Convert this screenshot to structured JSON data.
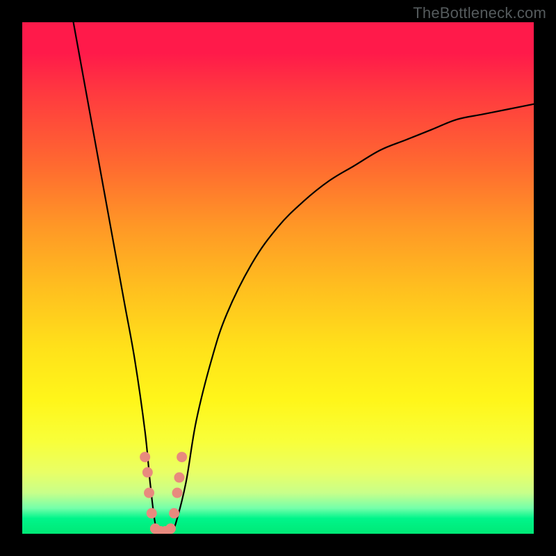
{
  "watermark": "TheBottleneck.com",
  "chart_data": {
    "type": "line",
    "title": "",
    "xlabel": "",
    "ylabel": "",
    "xlim": [
      0,
      100
    ],
    "ylim": [
      0,
      100
    ],
    "series": [
      {
        "name": "bottleneck-curve",
        "x": [
          10,
          12,
          14,
          16,
          18,
          20,
          22,
          24,
          25,
          26,
          27,
          28,
          29,
          30,
          32,
          34,
          37,
          40,
          45,
          50,
          55,
          60,
          65,
          70,
          75,
          80,
          85,
          90,
          95,
          100
        ],
        "values": [
          100,
          89,
          78,
          67,
          56,
          45,
          34,
          20,
          10,
          2,
          0,
          0,
          0,
          2,
          10,
          22,
          34,
          43,
          53,
          60,
          65,
          69,
          72,
          75,
          77,
          79,
          81,
          82,
          83,
          84
        ]
      }
    ],
    "highlight_points": {
      "name": "highlight-beads",
      "color": "#e88a7e",
      "points": [
        {
          "x": 24.0,
          "y": 15
        },
        {
          "x": 24.5,
          "y": 12
        },
        {
          "x": 24.8,
          "y": 8
        },
        {
          "x": 25.3,
          "y": 4
        },
        {
          "x": 26.0,
          "y": 1
        },
        {
          "x": 27.0,
          "y": 0.5
        },
        {
          "x": 28.0,
          "y": 0.5
        },
        {
          "x": 29.0,
          "y": 1
        },
        {
          "x": 29.7,
          "y": 4
        },
        {
          "x": 30.3,
          "y": 8
        },
        {
          "x": 30.7,
          "y": 11
        },
        {
          "x": 31.2,
          "y": 15
        }
      ]
    },
    "background_gradient": {
      "top": "#ff1a4a",
      "mid": "#ffe21a",
      "bottom": "#00e876"
    }
  }
}
